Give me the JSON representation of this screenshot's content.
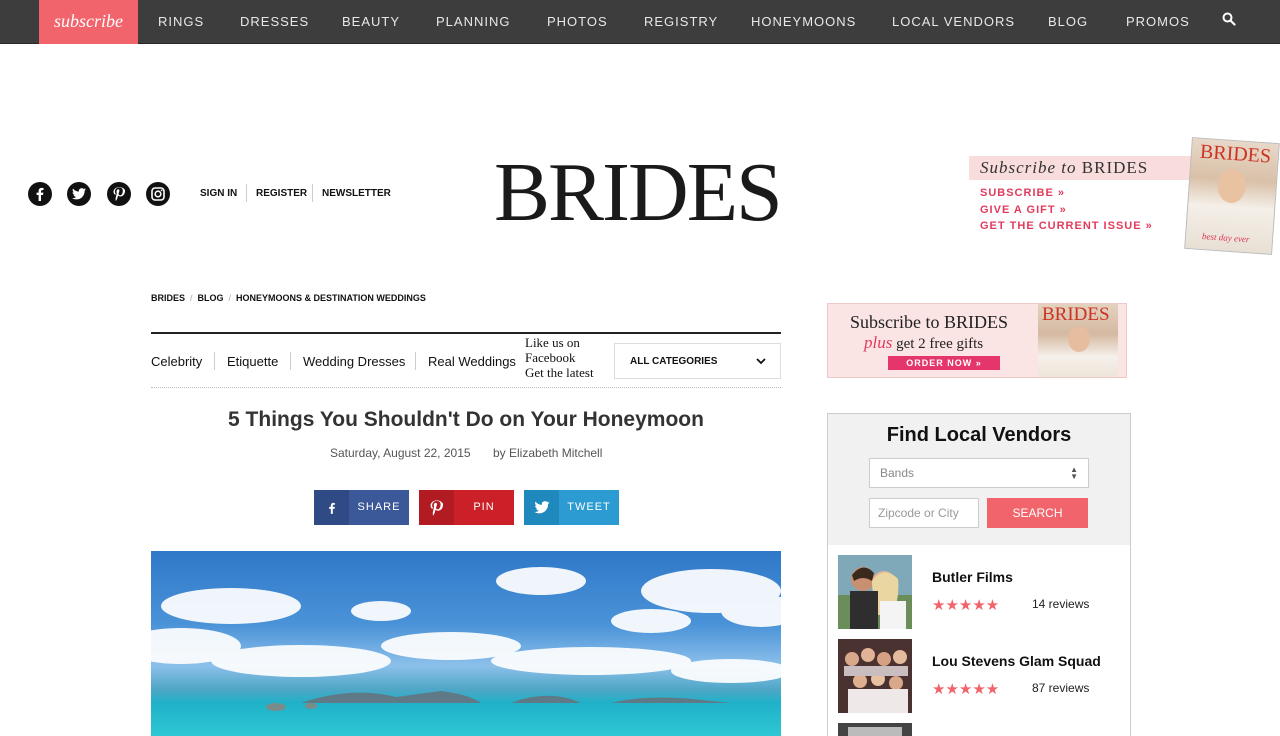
{
  "nav": {
    "subscribe": "subscribe",
    "items": [
      "RINGS",
      "DRESSES",
      "BEAUTY",
      "PLANNING",
      "PHOTOS",
      "REGISTRY",
      "HONEYMOONS",
      "LOCAL VENDORS",
      "BLOG",
      "PROMOS"
    ]
  },
  "header": {
    "logo": "BRIDES",
    "account": [
      "SIGN IN",
      "REGISTER",
      "NEWSLETTER"
    ],
    "social": [
      "facebook-icon",
      "twitter-icon",
      "pinterest-icon",
      "instagram-icon"
    ]
  },
  "promo": {
    "title_prefix": "Subscribe to ",
    "title_brand": "BRIDES",
    "links": [
      "SUBSCRIBE »",
      "GIVE A GIFT »",
      "GET THE CURRENT ISSUE »"
    ],
    "cover_logo": "BRIDES",
    "cover_text": "best day ever"
  },
  "breadcrumb": [
    "BRIDES",
    "BLOG",
    "HONEYMOONS & DESTINATION WEDDINGS"
  ],
  "categories": {
    "links": [
      "Celebrity",
      "Etiquette",
      "Wedding Dresses",
      "Real Weddings"
    ],
    "fb_like": [
      "Like us on",
      "Facebook",
      "Get the latest"
    ],
    "select_value": "ALL CATEGORIES"
  },
  "article": {
    "title": "5 Things You Shouldn't Do on Your Honeymoon",
    "date": "Saturday, August 22, 2015",
    "author": "by Elizabeth Mitchell",
    "share": [
      {
        "label": "SHARE",
        "icon": "facebook-icon",
        "color": "#3b5998"
      },
      {
        "label": "PIN",
        "icon": "pinterest-icon",
        "color": "#cb2027"
      },
      {
        "label": "TWEET",
        "icon": "twitter-icon",
        "color": "#2b9bd2"
      }
    ]
  },
  "sidebar_ad": {
    "line1_prefix": "Subscribe to ",
    "line1_brand": "BRIDES",
    "line2_em": "plus",
    "line2_rest": " get 2 free gifts",
    "button": "ORDER NOW »",
    "cover_logo": "BRIDES"
  },
  "vendors": {
    "title": "Find Local Vendors",
    "category_value": "Bands",
    "location_placeholder": "Zipcode or City",
    "search_label": "SEARCH",
    "list": [
      {
        "name": "Butler Films",
        "stars": "★★★★★",
        "rating": 5,
        "reviews": "14 reviews"
      },
      {
        "name": "Lou Stevens Glam Squad",
        "stars": "★★★★★",
        "rating": 4.5,
        "reviews": "87 reviews"
      }
    ]
  },
  "colors": {
    "accent": "#f1646b",
    "nav_bg": "#3d3d3d",
    "link_pink": "#e23b5d"
  }
}
